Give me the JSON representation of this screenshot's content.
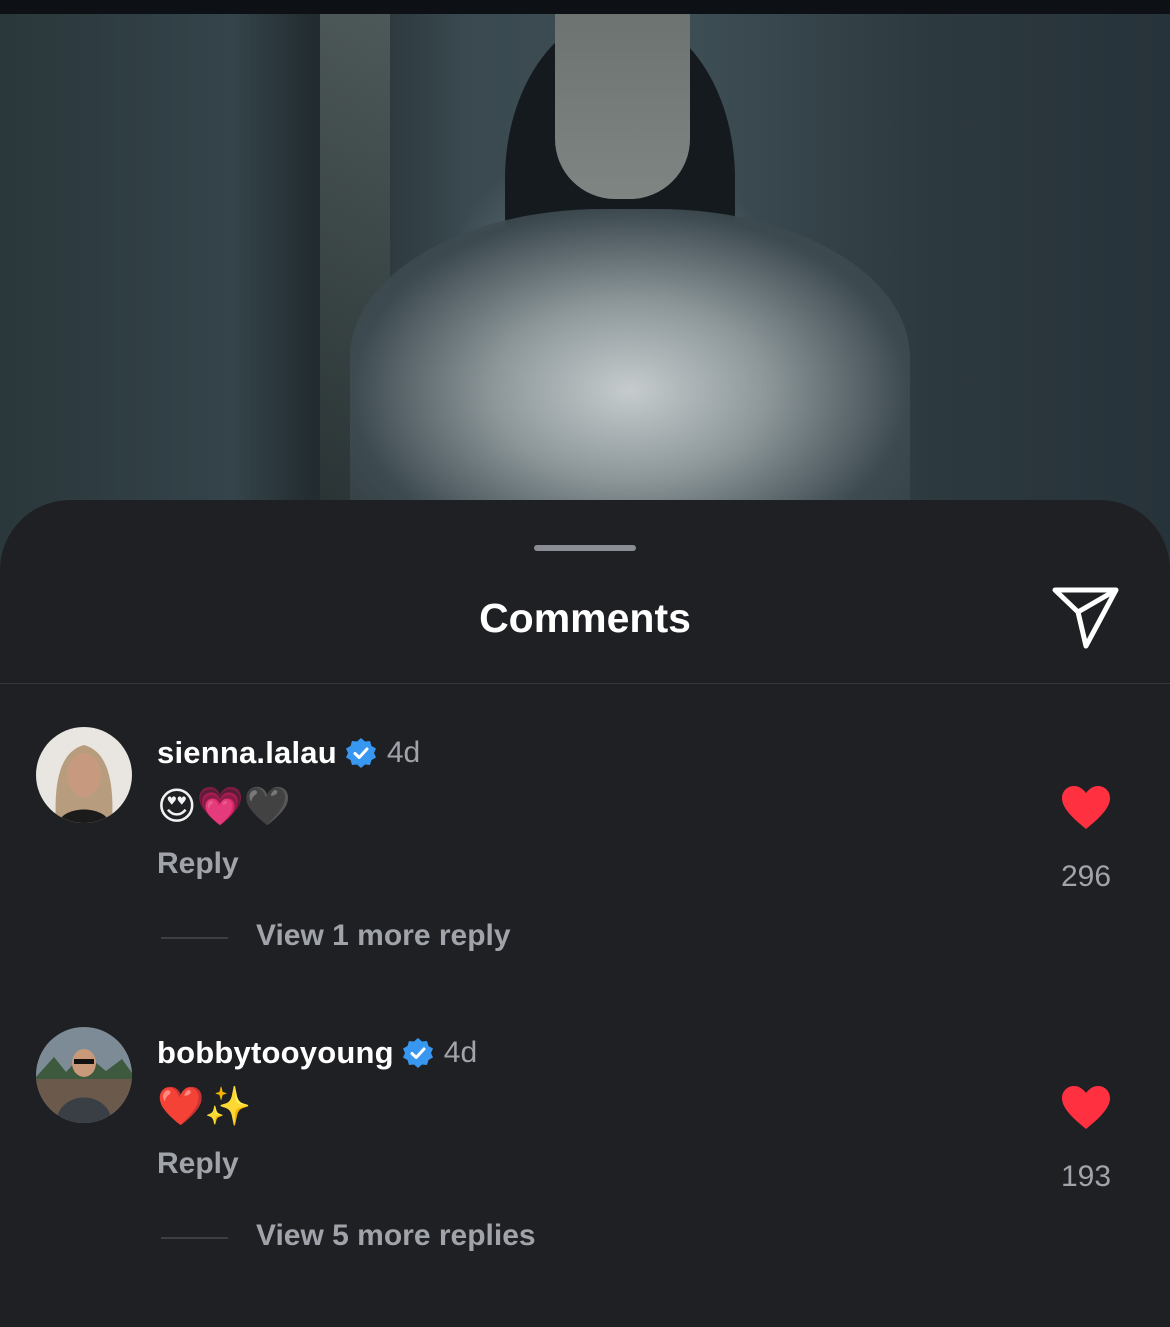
{
  "sheet": {
    "title": "Comments"
  },
  "comments": [
    {
      "username": "sienna.lalau",
      "time": "4d",
      "text": "😍💗🖤",
      "reply_label": "Reply",
      "likes": "296",
      "view_more": "View 1 more reply"
    },
    {
      "username": "bobbytooyoung",
      "time": "4d",
      "text": "❤️✨",
      "reply_label": "Reply",
      "likes": "193",
      "view_more": "View 5 more replies"
    }
  ],
  "icons": {
    "share": "send-icon",
    "verified": "verified-badge-icon",
    "like": "heart-icon"
  },
  "colors": {
    "background": "#1f2024",
    "verified": "#3897f0",
    "like": "#ff3040",
    "muted_text": "#a0a3a9"
  }
}
